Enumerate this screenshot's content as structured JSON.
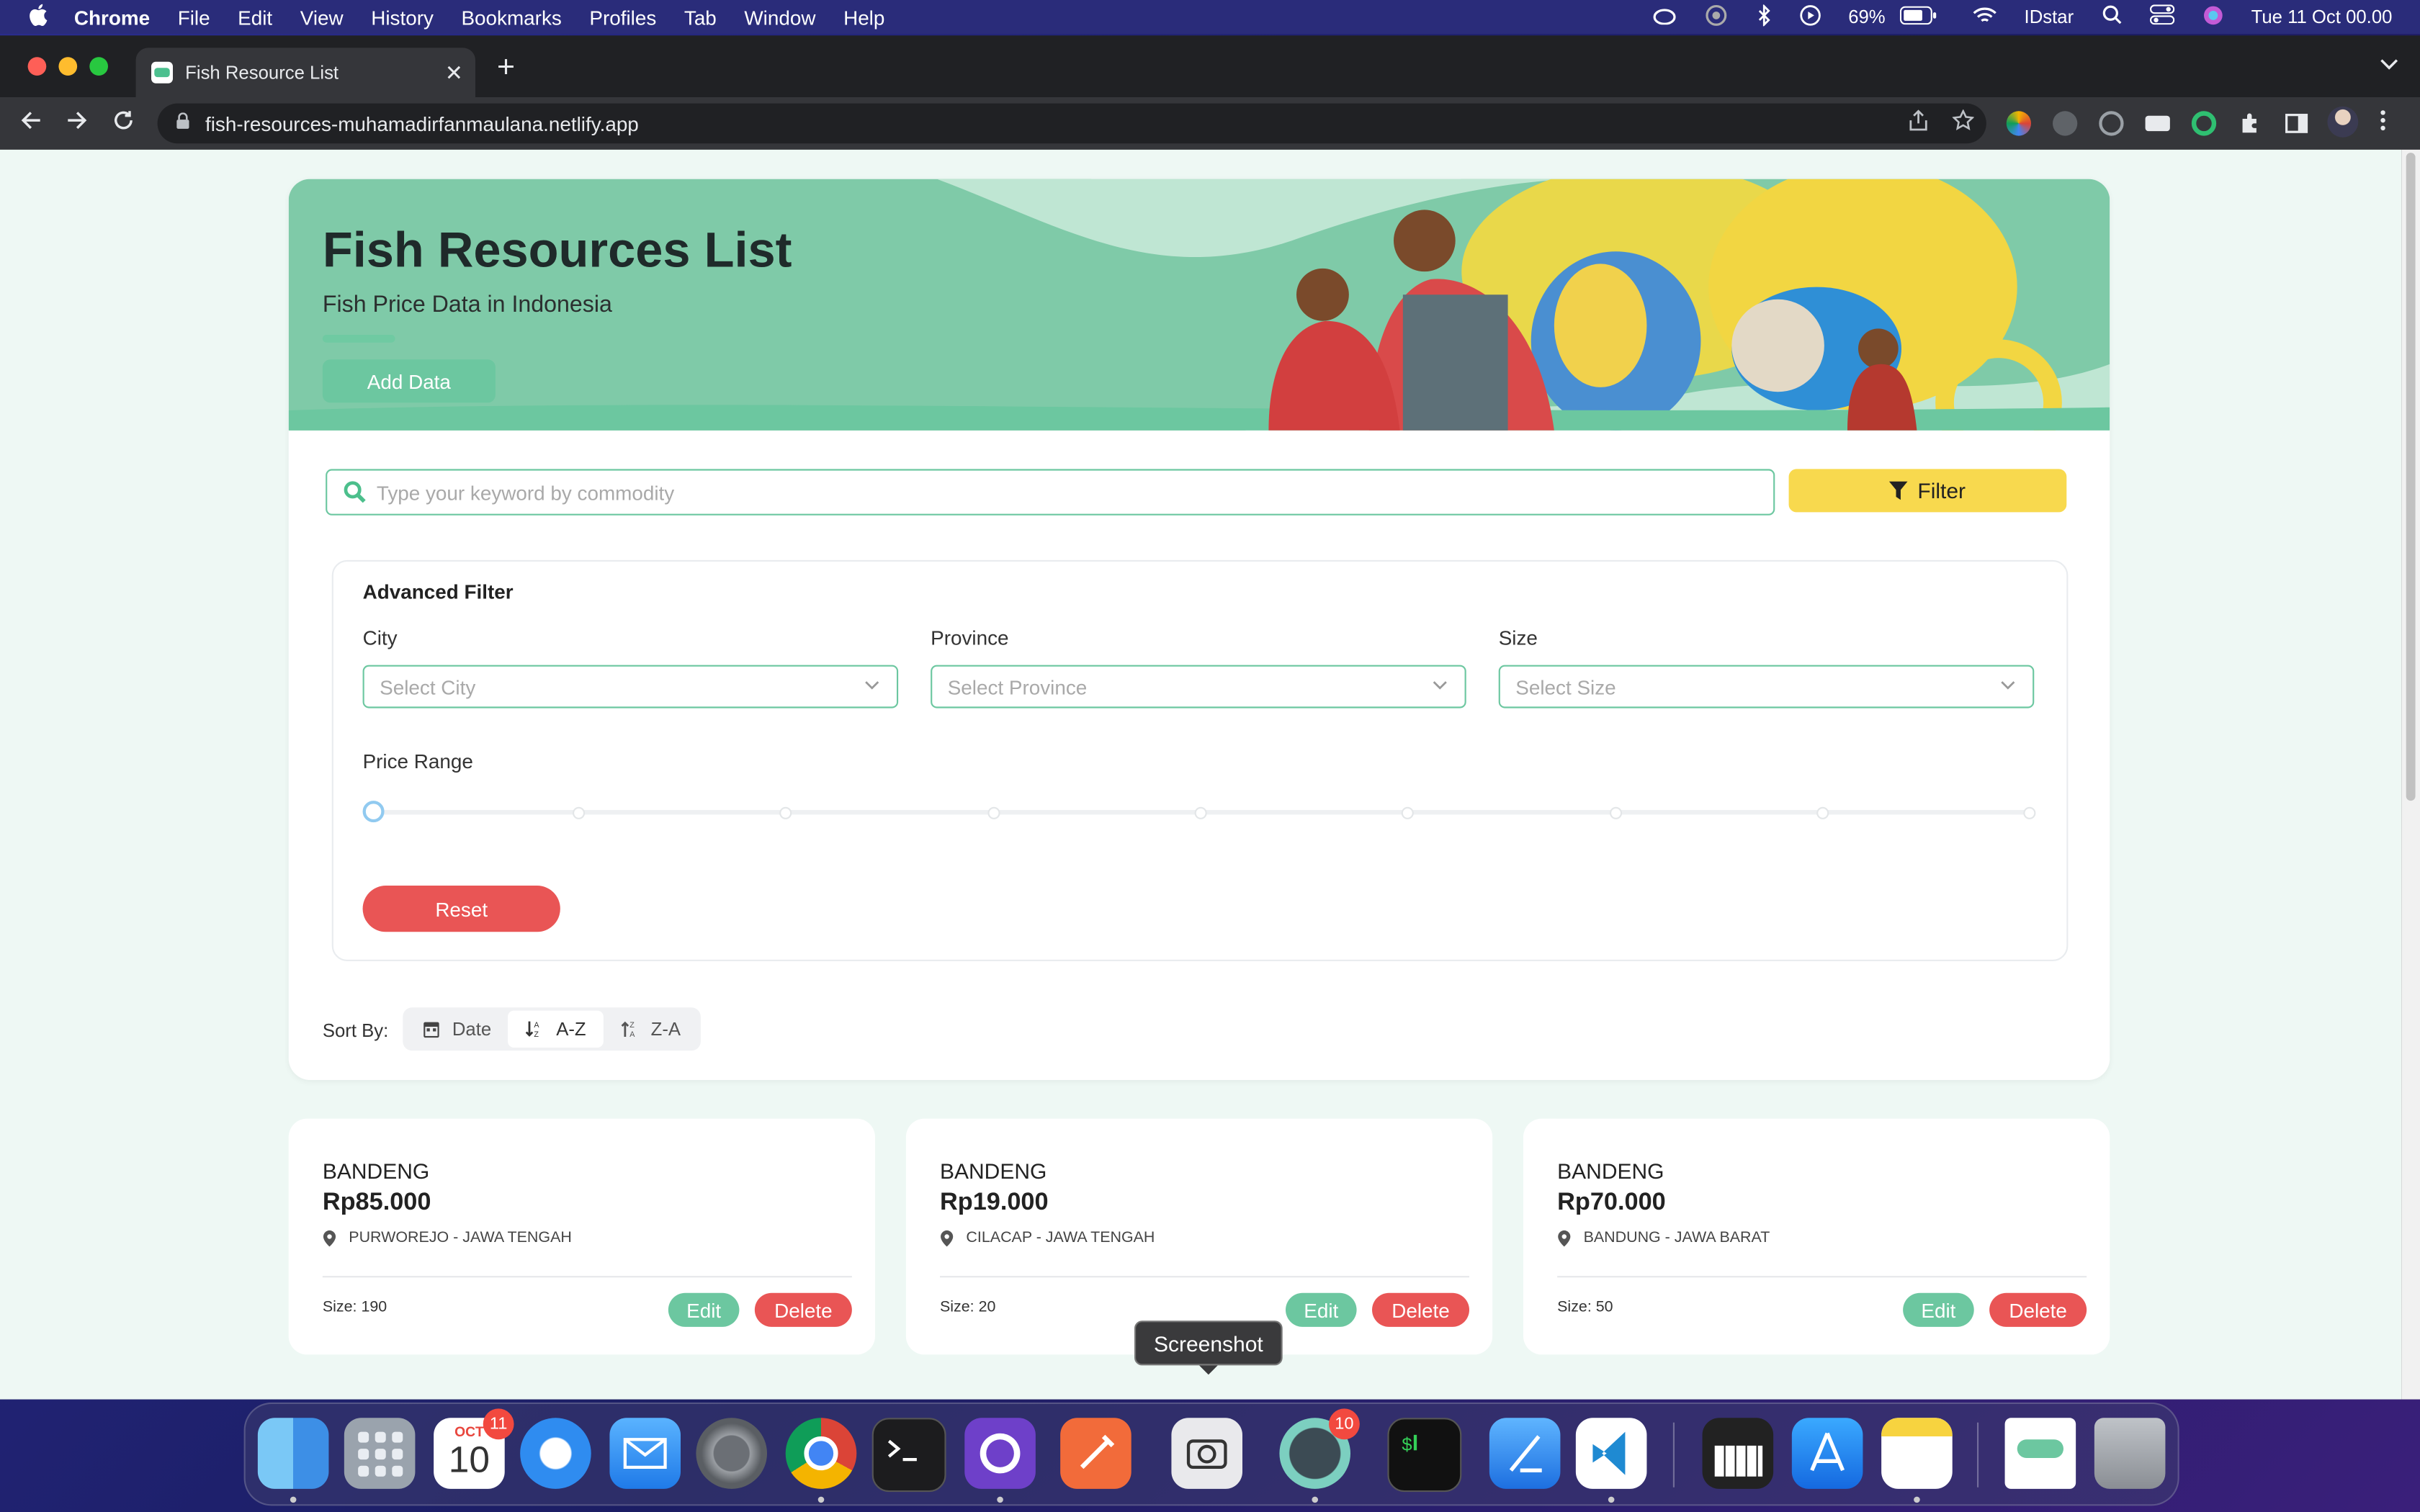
{
  "menubar": {
    "app": "Chrome",
    "items": [
      "File",
      "Edit",
      "View",
      "History",
      "Bookmarks",
      "Profiles",
      "Tab",
      "Window",
      "Help"
    ],
    "battery": "69%",
    "user": "IDstar",
    "datetime": "Tue 11 Oct  00.00"
  },
  "browser": {
    "tab_title": "Fish Resource List",
    "url": "fish-resources-muhamadirfanmaulana.netlify.app"
  },
  "hero": {
    "title": "Fish Resources List",
    "subtitle": "Fish Price Data in Indonesia",
    "add_button": "Add Data"
  },
  "search": {
    "placeholder": "Type your keyword by commodity",
    "filter_button": "Filter"
  },
  "advanced_filter": {
    "title": "Advanced Filter",
    "fields": [
      {
        "label": "City",
        "placeholder": "Select City"
      },
      {
        "label": "Province",
        "placeholder": "Select Province"
      },
      {
        "label": "Size",
        "placeholder": "Select Size"
      }
    ],
    "price_range_label": "Price Range",
    "price_range_value": 0,
    "reset_button": "Reset"
  },
  "sort": {
    "label": "Sort By:",
    "options": [
      "Date",
      "A-Z",
      "Z-A"
    ],
    "active": "A-Z"
  },
  "cards": [
    {
      "name": "BANDENG",
      "price": "Rp85.000",
      "location": "PURWOREJO - JAWA TENGAH",
      "size": "Size: 190",
      "edit": "Edit",
      "delete": "Delete"
    },
    {
      "name": "BANDENG",
      "price": "Rp19.000",
      "location": "CILACAP - JAWA TENGAH",
      "size": "Size: 20",
      "edit": "Edit",
      "delete": "Delete"
    },
    {
      "name": "BANDENG",
      "price": "Rp70.000",
      "location": "BANDUNG - JAWA BARAT",
      "size": "Size: 50",
      "edit": "Edit",
      "delete": "Delete"
    }
  ],
  "dock": {
    "tooltip": "Screenshot",
    "calendar_month": "OCT",
    "calendar_day": "10",
    "calendar_badge": "11",
    "app_badge": "10",
    "apps": [
      "finder",
      "launchpad",
      "calendar",
      "safari",
      "mail",
      "system-preferences",
      "chrome",
      "terminal",
      "github-desktop",
      "postman",
      "screenshot",
      "activity-app",
      "iterm",
      "xcode",
      "vscode",
      "piano",
      "app-store",
      "notes",
      "fish-resources-app",
      "trash"
    ]
  }
}
